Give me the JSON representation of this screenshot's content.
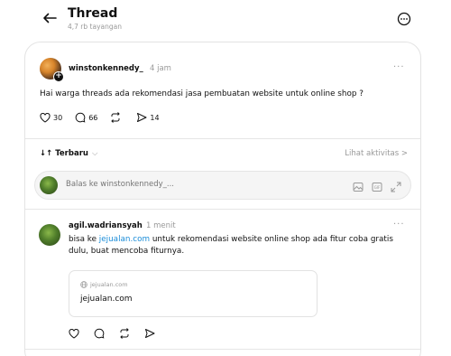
{
  "header": {
    "title": "Thread",
    "views": "4,7 rb tayangan"
  },
  "post": {
    "username": "winstonkennedy_",
    "time": "4 jam",
    "text": "Hai warga threads ada rekomendasi jasa pembuatan website untuk online shop ?",
    "likes": "30",
    "replies": "66",
    "shares": "14"
  },
  "sort": {
    "label": "Terbaru",
    "activity_link": "Lihat aktivitas >"
  },
  "reply": {
    "placeholder": "Balas ke winstonkennedy_..."
  },
  "comment": {
    "username": "agil.wadriansyah",
    "time": "1 menit",
    "text_prefix": "bisa ke ",
    "link": "jejualan.com",
    "text_suffix": " untuk rekomendasi website online shop ada fitur coba gratis dulu, buat mencoba fiturnya.",
    "preview_domain": "jejualan.com",
    "preview_title": "jejualan.com"
  },
  "colors": {
    "link": "#1a8cd8",
    "muted": "#999999"
  }
}
